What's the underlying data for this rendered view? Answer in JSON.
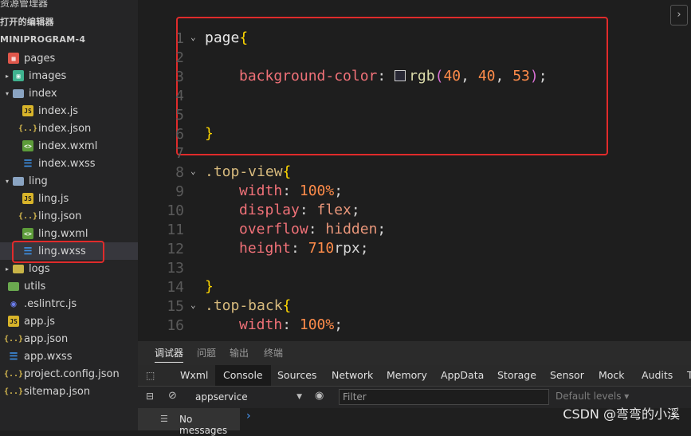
{
  "sidebar": {
    "section_top": "资源管理器",
    "open_editors": "打开的编辑器",
    "project_name": "MINIPROGRAM-4",
    "tree": [
      {
        "label": "pages",
        "icon": "pages-folder-icon"
      },
      {
        "label": "images",
        "icon": "images-folder-icon"
      },
      {
        "label": "index",
        "icon": "folder-icon"
      },
      {
        "label": "index.js",
        "icon": "js-file-icon"
      },
      {
        "label": "index.json",
        "icon": "json-file-icon"
      },
      {
        "label": "index.wxml",
        "icon": "wxml-file-icon"
      },
      {
        "label": "index.wxss",
        "icon": "wxss-file-icon"
      },
      {
        "label": "ling",
        "icon": "folder-icon"
      },
      {
        "label": "ling.js",
        "icon": "js-file-icon"
      },
      {
        "label": "ling.json",
        "icon": "json-file-icon"
      },
      {
        "label": "ling.wxml",
        "icon": "wxml-file-icon"
      },
      {
        "label": "ling.wxss",
        "icon": "wxss-file-icon"
      },
      {
        "label": "logs",
        "icon": "folder-icon"
      },
      {
        "label": "utils",
        "icon": "folder-icon"
      },
      {
        "label": ".eslintrc.js",
        "icon": "eslint-icon"
      },
      {
        "label": "app.js",
        "icon": "js-file-icon"
      },
      {
        "label": "app.json",
        "icon": "json-file-icon"
      },
      {
        "label": "app.wxss",
        "icon": "wxss-file-icon"
      },
      {
        "label": "project.config.json",
        "icon": "json-file-icon"
      },
      {
        "label": "sitemap.json",
        "icon": "json-file-icon"
      }
    ]
  },
  "editor": {
    "line_numbers": [
      "1",
      "2",
      "3",
      "4",
      "5",
      "6",
      "7",
      "8",
      "9",
      "10",
      "11",
      "12",
      "13",
      "14",
      "15",
      "16"
    ],
    "lines": {
      "l1_selector": "page",
      "l3_prop": "background-color",
      "l3_fn": "rgb",
      "l3_num1": "40",
      "l3_num2": "40",
      "l3_num3": "53",
      "l8_selector": ".top-view",
      "l9_prop": "width",
      "l9_val": "100%",
      "l10_prop": "display",
      "l10_val": "flex",
      "l11_prop": "overflow",
      "l11_val": "hidden",
      "l12_prop": "height",
      "l12_num": "710",
      "l12_unit": "rpx",
      "l15_selector": ".top-back",
      "l16_prop": "width",
      "l16_val": "100%"
    },
    "swatch_color": "#282835"
  },
  "panel": {
    "tabs": [
      "调试器",
      "问题",
      "输出",
      "终端"
    ],
    "devtools_tabs": [
      "Wxml",
      "Console",
      "Sources",
      "Network",
      "Memory",
      "AppData",
      "Storage",
      "Sensor",
      "Mock",
      "Audits",
      "T"
    ],
    "context": "appservice",
    "filter_placeholder": "Filter",
    "levels": "Default levels",
    "no_messages": "No messages"
  },
  "watermark": "CSDN @弯弯的小溪",
  "colors": {
    "highlight": "#e02b2b",
    "background": "#1e1e1e",
    "sidebar": "#252526"
  }
}
